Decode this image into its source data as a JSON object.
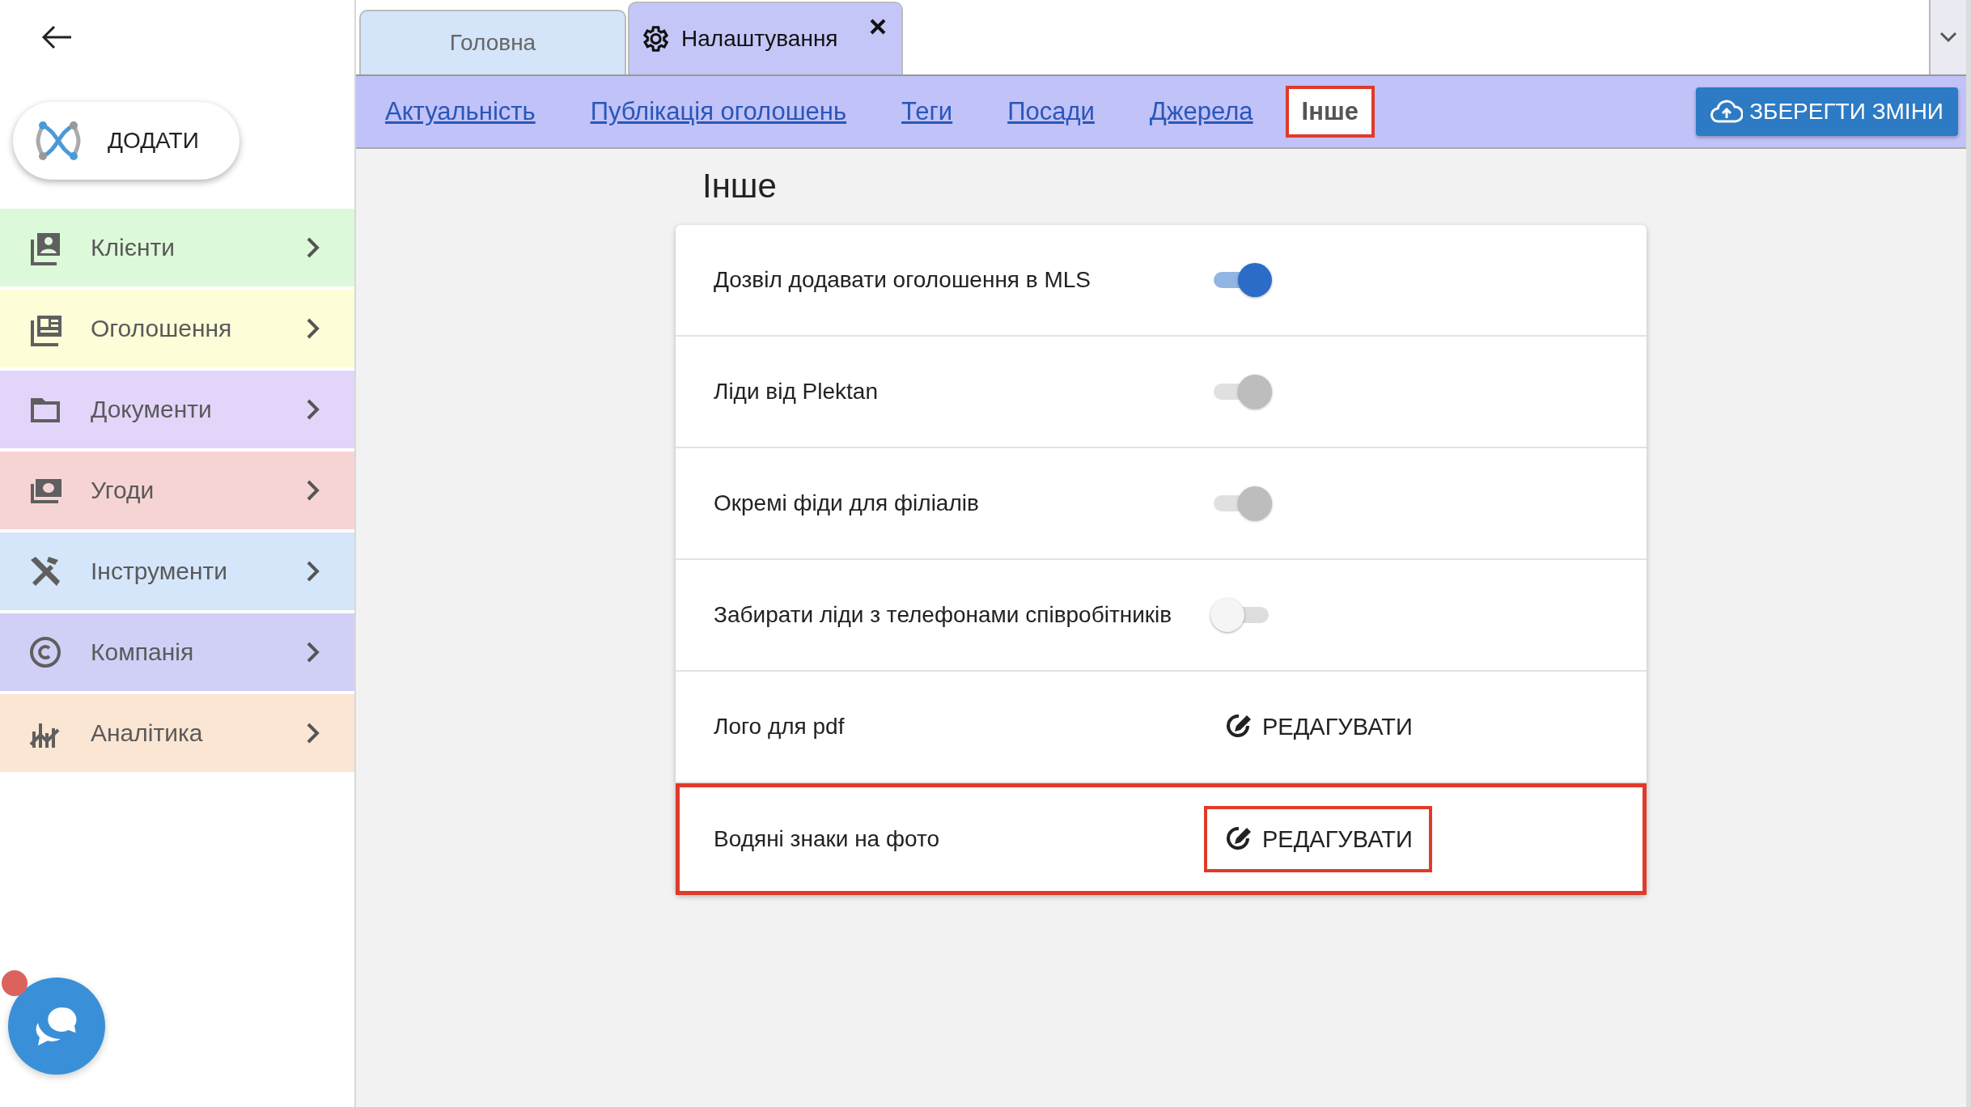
{
  "sidebar": {
    "add_button": {
      "label": "ДОДАТИ"
    },
    "items": [
      {
        "label": "Клієнти",
        "color": "#dcfad9"
      },
      {
        "label": "Оголошення",
        "color": "#fdfdd8"
      },
      {
        "label": "Документи",
        "color": "#e3d5fa"
      },
      {
        "label": "Угоди",
        "color": "#f7d4d4"
      },
      {
        "label": "Інструменти",
        "color": "#d5e6fb"
      },
      {
        "label": "Компанія",
        "color": "#d0d0f7"
      },
      {
        "label": "Аналітика",
        "color": "#fae6d3"
      }
    ]
  },
  "tabs": [
    {
      "label": "Головна",
      "selected": false
    },
    {
      "label": "Налаштування",
      "selected": true
    }
  ],
  "sub_tabs": [
    {
      "label": "Актуальність",
      "selected": false,
      "highlighted": false
    },
    {
      "label": "Публікація оголошень",
      "selected": false,
      "highlighted": false
    },
    {
      "label": "Теги",
      "selected": false,
      "highlighted": false
    },
    {
      "label": "Посади",
      "selected": false,
      "highlighted": false
    },
    {
      "label": "Джерела",
      "selected": false,
      "highlighted": false
    },
    {
      "label": "Інше",
      "selected": true,
      "highlighted": true
    }
  ],
  "save_button": {
    "label": "ЗБЕРЕГТИ ЗМІНИ"
  },
  "section_title": "Інше",
  "settings": [
    {
      "kind": "toggle",
      "label": "Дозвіл додавати оголошення в MLS",
      "on": true,
      "disabled": false,
      "highlighted": false
    },
    {
      "kind": "toggle",
      "label": "Ліди від Plektan",
      "on": true,
      "disabled": true,
      "highlighted": false
    },
    {
      "kind": "toggle",
      "label": "Окремі фіди для філіалів",
      "on": true,
      "disabled": true,
      "highlighted": false
    },
    {
      "kind": "toggle",
      "label": "Забирати ліди з телефонами співробітників",
      "on": false,
      "disabled": false,
      "highlighted": false
    },
    {
      "kind": "edit",
      "label": "Лого для pdf",
      "button": "РЕДАГУВАТИ",
      "highlighted": false,
      "button_highlighted": false
    },
    {
      "kind": "edit",
      "label": "Водяні знаки на фото",
      "button": "РЕДАГУВАТИ",
      "highlighted": true,
      "button_highlighted": true
    }
  ],
  "chat": {
    "notification": true
  }
}
